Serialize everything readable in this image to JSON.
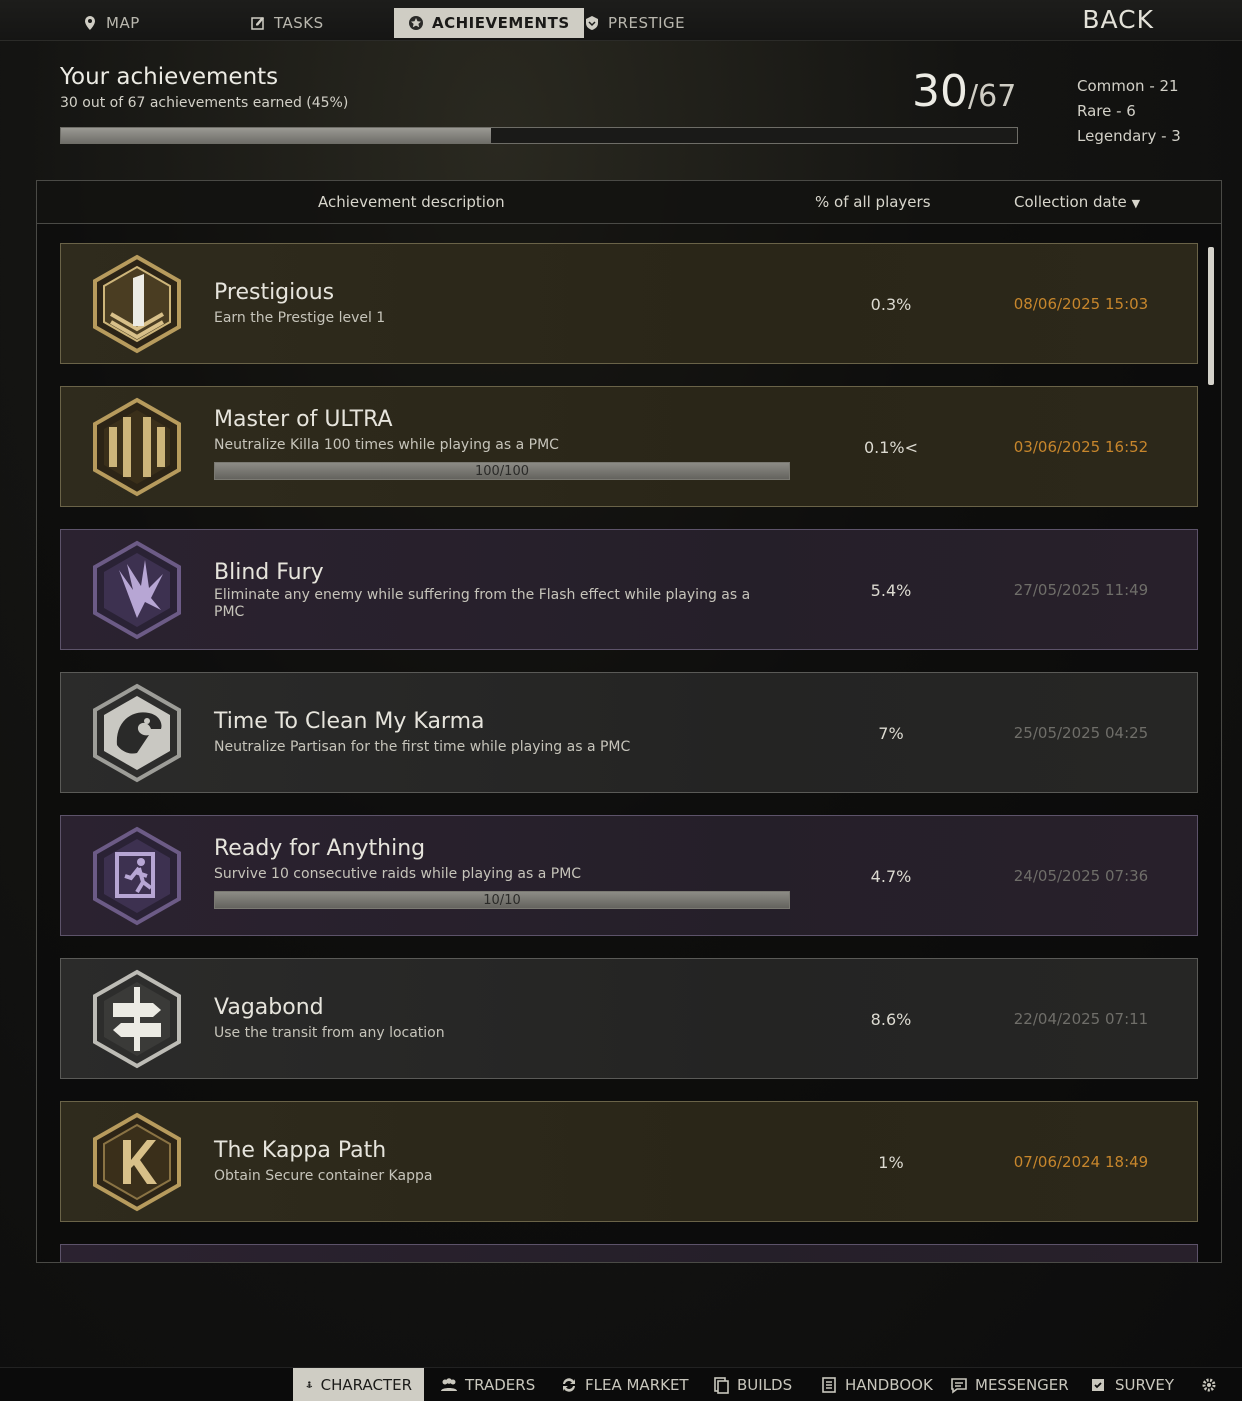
{
  "tabs": [
    {
      "label": "MAP",
      "icon": "map-pin-icon"
    },
    {
      "label": "TASKS",
      "icon": "tasks-icon"
    },
    {
      "label": "ACHIEVEMENTS",
      "icon": "achievement-icon",
      "active": true
    },
    {
      "label": "PRESTIGE",
      "icon": "prestige-icon"
    }
  ],
  "back_label": "BACK",
  "summary": {
    "title": "Your achievements",
    "subtitle": "30 out of 67 achievements earned (45%)",
    "earned": "30",
    "total": "/67",
    "progress_fraction": 0.45,
    "rarity": [
      "Common - 21",
      "Rare - 6",
      "Legendary - 3"
    ]
  },
  "table": {
    "headers": {
      "description": "Achievement description",
      "percent": "% of all players",
      "date": "Collection date"
    },
    "rows": [
      {
        "name": "Prestigious",
        "desc": "Earn the Prestige level 1",
        "percent": "0.3%",
        "date": "08/06/2025 15:03",
        "rarity": "gold",
        "badge": "prestige-level-1-badge-icon"
      },
      {
        "name": "Master of ULTRA",
        "desc": "Neutralize Killa 100 times while playing as a PMC",
        "progress": "100/100",
        "progress_fraction": 1.0,
        "percent": "0.1%<",
        "date": "03/06/2025 16:52",
        "rarity": "gold",
        "badge": "stripes-badge-icon"
      },
      {
        "name": "Blind Fury",
        "desc": "Eliminate any enemy while suffering from the Flash effect while playing as a PMC",
        "percent": "5.4%",
        "date": "27/05/2025 11:49",
        "rarity": "purple",
        "badge": "flash-badge-icon"
      },
      {
        "name": "Time To Clean My Karma",
        "desc": "Neutralize Partisan for the first time while playing as a PMC",
        "percent": "7%",
        "date": "25/05/2025 04:25",
        "rarity": "gray",
        "badge": "eagle-badge-icon"
      },
      {
        "name": "Ready for Anything",
        "desc": "Survive 10 consecutive raids while playing as a PMC",
        "progress": "10/10",
        "progress_fraction": 1.0,
        "percent": "4.7%",
        "date": "24/05/2025 07:36",
        "rarity": "purple",
        "badge": "exit-badge-icon"
      },
      {
        "name": "Vagabond",
        "desc": "Use the transit from any location",
        "percent": "8.6%",
        "date": "22/04/2025 07:11",
        "rarity": "gray",
        "badge": "signpost-badge-icon"
      },
      {
        "name": "The Kappa Path",
        "desc": "Obtain Secure container Kappa",
        "percent": "1%",
        "date": "07/06/2024 18:49",
        "rarity": "gold",
        "badge": "kappa-badge-icon"
      }
    ]
  },
  "bottom_nav": [
    {
      "label": "CHARACTER",
      "icon": "character-icon",
      "active": true
    },
    {
      "label": "TRADERS",
      "icon": "traders-icon"
    },
    {
      "label": "FLEA MARKET",
      "icon": "flea-market-icon"
    },
    {
      "label": "BUILDS",
      "icon": "builds-icon"
    },
    {
      "label": "HANDBOOK",
      "icon": "handbook-icon"
    },
    {
      "label": "MESSENGER",
      "icon": "messenger-icon"
    },
    {
      "label": "SURVEY",
      "icon": "survey-icon"
    }
  ]
}
